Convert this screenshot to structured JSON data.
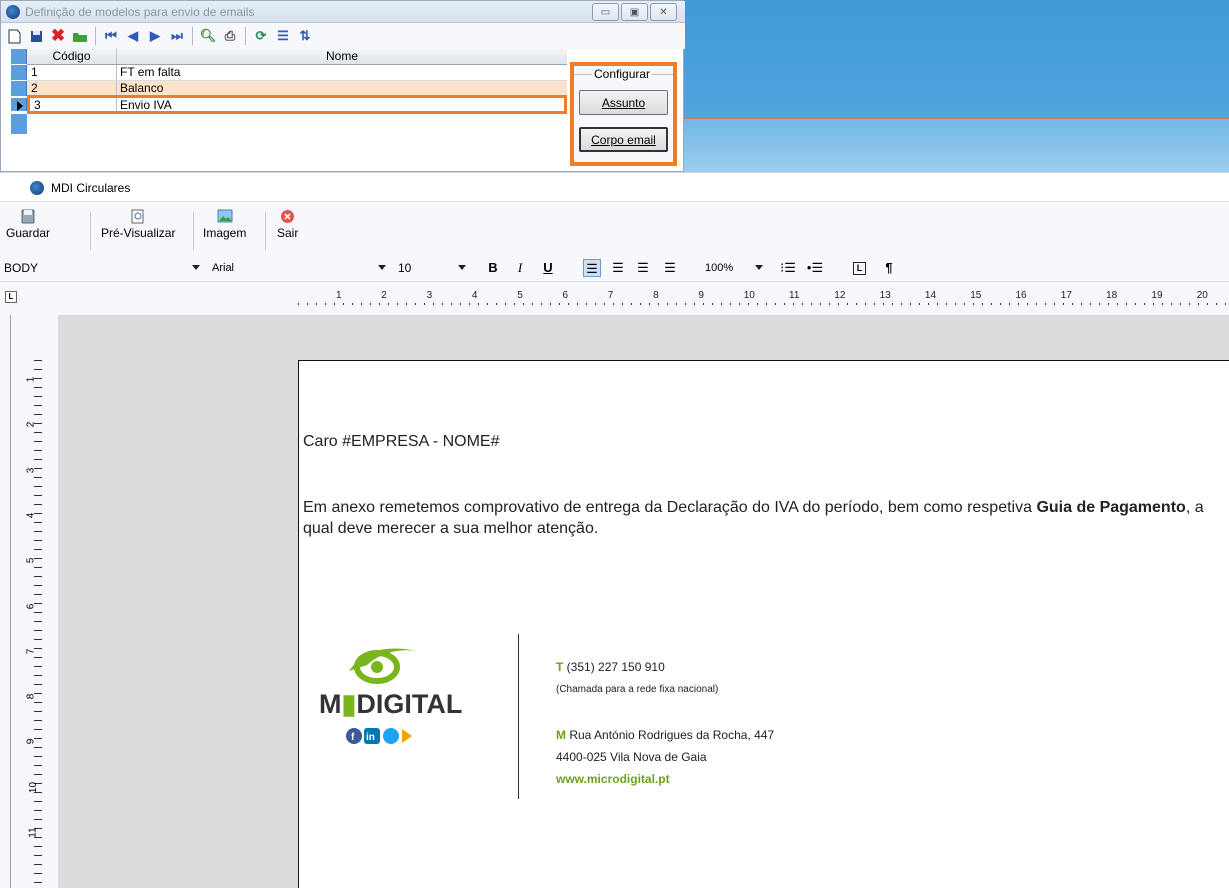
{
  "top_window": {
    "title": "Definição de modelos para envio de emails",
    "columns": {
      "code": "Código",
      "name": "Nome"
    },
    "rows": [
      {
        "code": "1",
        "name": "FT em falta"
      },
      {
        "code": "2",
        "name": "Balanco"
      },
      {
        "code": "3",
        "name": "Envio IVA"
      }
    ],
    "selected_row": "3",
    "configure": {
      "legend": "Configurar",
      "subject_button": "Assunto",
      "body_button": "Corpo email"
    }
  },
  "mdi": {
    "title": "MDI Circulares",
    "toolbar": {
      "save": "Guardar",
      "preview": "Pré-Visualizar",
      "image": "Imagem",
      "exit": "Sair"
    },
    "format": {
      "style": "BODY",
      "font": "Arial",
      "size": "10",
      "zoom": "100%"
    },
    "ruler_numbers": [
      "1",
      "2",
      "3",
      "4",
      "5",
      "6",
      "7",
      "8",
      "9",
      "10",
      "11",
      "12",
      "13",
      "14",
      "15",
      "16",
      "17",
      "18",
      "19",
      "20"
    ],
    "vruler_numbers": [
      "1",
      "2",
      "3",
      "4",
      "5",
      "6",
      "7",
      "8",
      "9",
      "10",
      "11"
    ]
  },
  "document": {
    "greeting": "Caro #EMPRESA - NOME#",
    "body_part1": "Em anexo remetemos comprovativo de entrega da Declaração do IVA do período, bem como respetiva ",
    "body_bold": "Guia de Pagamento",
    "body_part2": ", a qual deve merecer a sua melhor atenção.",
    "signature": {
      "logo_text": "MDIGITAL",
      "phone_label": "T",
      "phone": " (351) 227 150 910",
      "phone_note": "(Chamada para a rede fixa nacional)",
      "address_label": "M",
      "address_line1": " Rua António Rodrigues da Rocha, 447",
      "address_line2": "4400-025 Vila Nova de Gaia",
      "website": "www.microdigital.pt"
    }
  },
  "colors": {
    "highlight": "#f07c23",
    "brand_green": "#6aa31c"
  }
}
